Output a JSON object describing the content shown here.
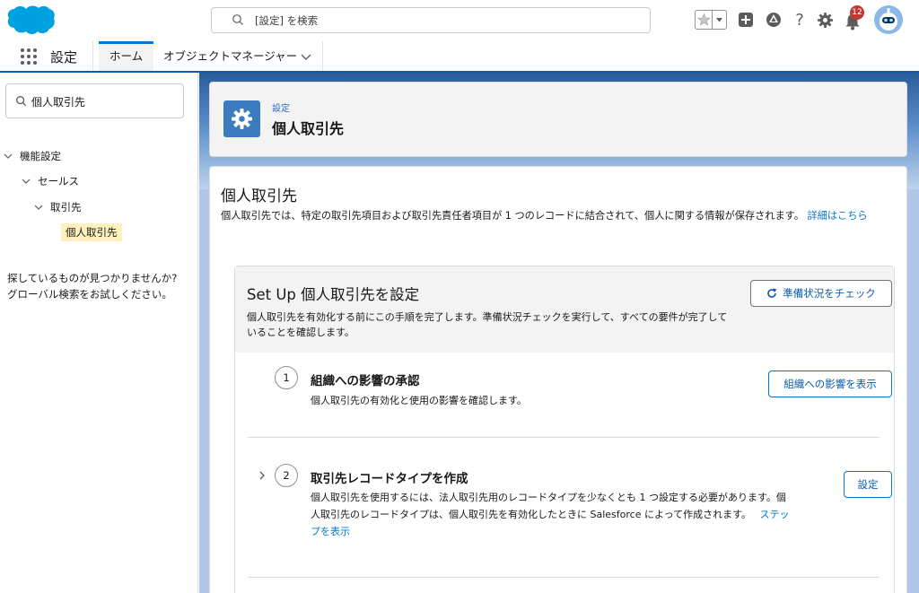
{
  "header": {
    "search_placeholder": "[設定] を検索",
    "notification_count": "12",
    "colors": {
      "brand": "#00a1e0",
      "accent": "#0176d3",
      "badge": "#c23934"
    },
    "icons": [
      "salesforce-logo",
      "search-icon",
      "star-icon",
      "chevron-down-icon",
      "add-icon",
      "trailhead-icon",
      "help-icon",
      "gear-icon",
      "bell-icon",
      "avatar"
    ]
  },
  "nav": {
    "app_name": "設定",
    "tabs": [
      {
        "label": "ホーム",
        "active": true
      },
      {
        "label": "オブジェクトマネージャー",
        "active": false
      }
    ]
  },
  "sidebar": {
    "search_value": "個人取引先",
    "tree": {
      "level1": "機能設定",
      "level2": "セールス",
      "level3": "取引先",
      "selected": "個人取引先"
    },
    "help_line1": "探しているものが見つかりませんか?",
    "help_line2": "グローバル検索をお試しください。"
  },
  "page_header": {
    "breadcrumb": "設定",
    "title": "個人取引先"
  },
  "content": {
    "title": "個人取引先",
    "description": "個人取引先では、特定の取引先項目および取引先責任者項目が 1 つのレコードに結合されて、個人に関する情報が保存されます。",
    "learn_more": "詳細はこちら"
  },
  "setup": {
    "title": "Set Up 個人取引先を設定",
    "subtitle": "個人取引先を有効化する前にこの手順を完了します。準備状況チェックを実行して、すべての要件が完了していることを確認します。",
    "check_button": "準備状況をチェック",
    "steps": [
      {
        "number": "1",
        "title": "組織への影響の承認",
        "desc": "個人取引先の有効化と使用の影響を確認します。",
        "button": "組織への影響を表示"
      },
      {
        "number": "2",
        "title": "取引先レコードタイプを作成",
        "desc": "個人取引先を使用するには、法人取引先用のレコードタイプを少なくとも 1 つ設定する必要があります。個人取引先のレコードタイプは、個人取引先を有効化したときに Salesforce によって作成されます。",
        "link": "ステップを表示",
        "button": "設定"
      }
    ]
  }
}
